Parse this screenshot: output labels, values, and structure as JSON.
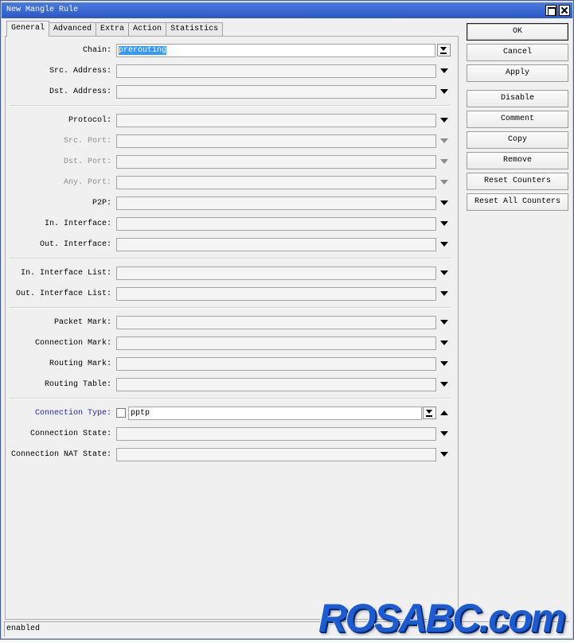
{
  "window": {
    "title": "New Mangle Rule",
    "controls": [
      "maximize-icon",
      "close-icon"
    ]
  },
  "tabs": [
    {
      "label": "General",
      "selected": true
    },
    {
      "label": "Advanced",
      "selected": false
    },
    {
      "label": "Extra",
      "selected": false
    },
    {
      "label": "Action",
      "selected": false
    },
    {
      "label": "Statistics",
      "selected": false
    }
  ],
  "form": {
    "rows": [
      {
        "label": "Chain:",
        "value": "prerouting",
        "value_selected": true,
        "button_icon": "dropdown-list-icon"
      },
      {
        "label": "Src. Address:",
        "value": "",
        "toggle_icon": "triangle-down-icon"
      },
      {
        "label": "Dst. Address:",
        "value": "",
        "toggle_icon": "triangle-down-icon"
      },
      {
        "label": "Protocol:",
        "value": "",
        "toggle_icon": "triangle-down-icon"
      },
      {
        "label": "Src. Port:",
        "value": "",
        "disabled": true,
        "toggle_icon": "triangle-down-icon"
      },
      {
        "label": "Dst. Port:",
        "value": "",
        "disabled": true,
        "toggle_icon": "triangle-down-icon"
      },
      {
        "label": "Any. Port:",
        "value": "",
        "disabled": true,
        "toggle_icon": "triangle-down-icon"
      },
      {
        "label": "P2P:",
        "value": "",
        "toggle_icon": "triangle-down-icon"
      },
      {
        "label": "In. Interface:",
        "value": "",
        "toggle_icon": "triangle-down-icon"
      },
      {
        "label": "Out. Interface:",
        "value": "",
        "toggle_icon": "triangle-down-icon"
      },
      {
        "label": "In. Interface List:",
        "value": "",
        "toggle_icon": "triangle-down-icon"
      },
      {
        "label": "Out. Interface List:",
        "value": "",
        "toggle_icon": "triangle-down-icon"
      },
      {
        "label": "Packet Mark:",
        "value": "",
        "toggle_icon": "triangle-down-icon"
      },
      {
        "label": "Connection Mark:",
        "value": "",
        "toggle_icon": "triangle-down-icon"
      },
      {
        "label": "Routing Mark:",
        "value": "",
        "toggle_icon": "triangle-down-icon"
      },
      {
        "label": "Routing Table:",
        "value": "",
        "toggle_icon": "triangle-down-icon"
      },
      {
        "label": "Connection Type:",
        "value": "pptp",
        "highlighted": true,
        "negate_checked": false,
        "button_icon": "dropdown-list-icon",
        "toggle_icon": "triangle-up-icon"
      },
      {
        "label": "Connection State:",
        "value": "",
        "toggle_icon": "triangle-down-icon"
      },
      {
        "label": "Connection NAT State:",
        "value": "",
        "toggle_icon": "triangle-down-icon"
      }
    ]
  },
  "buttons": [
    {
      "label": "OK",
      "default": true
    },
    {
      "label": "Cancel"
    },
    {
      "label": "Apply"
    },
    {
      "label": "Disable"
    },
    {
      "label": "Comment"
    },
    {
      "label": "Copy"
    },
    {
      "label": "Remove"
    },
    {
      "label": "Reset Counters"
    },
    {
      "label": "Reset All Counters"
    }
  ],
  "status_bar": {
    "text": "enabled"
  },
  "watermark": {
    "text": "ROSABC.com"
  },
  "colors": {
    "titlebar": "#2b58c2",
    "titlebar_light": "#4a7be0",
    "highlight": "#3399ff",
    "link_label": "#1f1fb0",
    "disabled_text": "#8c8c8c",
    "watermark": "#1d5bd0"
  }
}
